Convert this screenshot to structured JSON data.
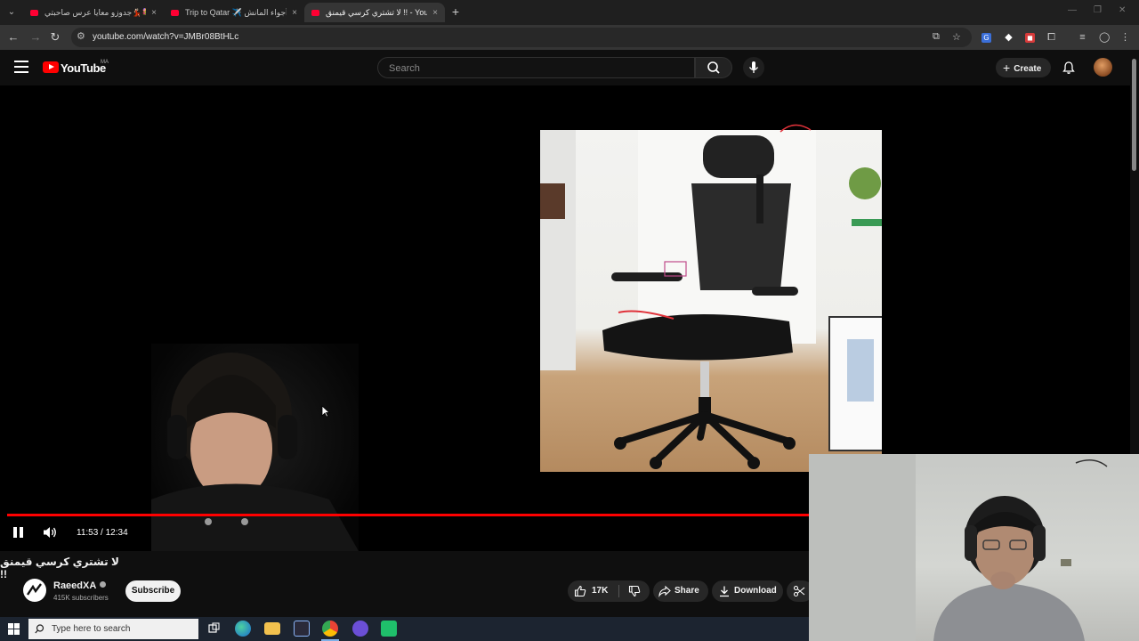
{
  "browser": {
    "tabs": [
      {
        "title": "جدوزو معايا عرس صاحبتي💃🏻💐",
        "close": "×"
      },
      {
        "title": "Trip to Qatar ✈️ أجواء المانش",
        "close": "×"
      },
      {
        "title": "لا تشتري كرسي قيمنق !!  - YouTube",
        "close": "×"
      }
    ],
    "new_tab": "+",
    "url": "youtube.com/watch?v=JMBr08BtHLc"
  },
  "youtube": {
    "logo_text": "YouTube",
    "country_code": "MA",
    "search_placeholder": "Search",
    "create_label": "Create"
  },
  "player": {
    "current_time": "11:53",
    "duration": "12:34",
    "time_display": "11:53 / 12:34",
    "progress_fraction": 0.944,
    "state": "playing"
  },
  "video": {
    "title": "لا تشتري كرسي قيمنق !!",
    "channel_name": "RaeedXA",
    "subscribers": "415K subscribers",
    "subscribe_label": "Subscribe",
    "likes": "17K",
    "share_label": "Share",
    "download_label": "Download"
  },
  "taskbar": {
    "search_placeholder": "Type here to search"
  },
  "colors": {
    "youtube_red": "#ff0000",
    "background": "#0f0f0f",
    "pill": "#272727"
  }
}
